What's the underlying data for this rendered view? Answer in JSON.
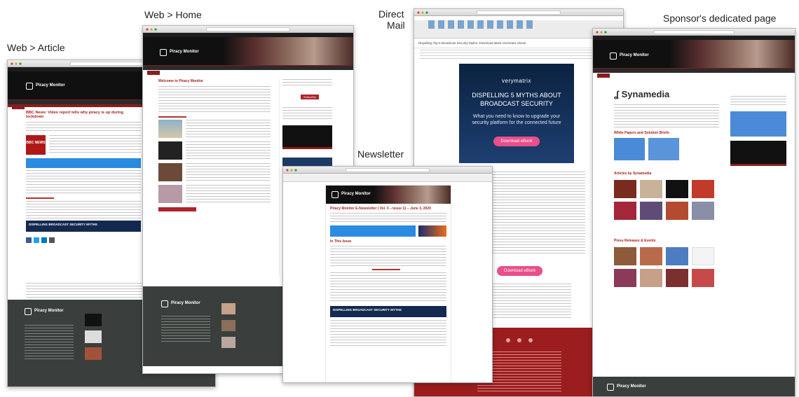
{
  "captions": {
    "web_article": "Web > Article",
    "web_home": "Web > Home",
    "direct_mail_line1": "Direct",
    "direct_mail_line2": "Mail",
    "newsletter": "Newsletter",
    "sponsor_page": "Sponsor's dedicated page"
  },
  "brand": {
    "name": "Piracy Monitor"
  },
  "article": {
    "headline": "BBC News: Video report tells why piracy is up during lockdown",
    "bbc_label": "BBC NEWS",
    "banner_text": "DISPELLING BROADCAST SECURITY MYTHS"
  },
  "home": {
    "welcome_title": "Welcome to Piracy Monitor",
    "subscribe_button": "Subscribe"
  },
  "direct_mail": {
    "subject": "Dispelling Top 5 Broadcast Security Myths: Download latest Verimatrix ebook",
    "ad_brand": "verymatrix",
    "ad_headline": "DISPELLING 5 MYTHS ABOUT BROADCAST SECURITY",
    "ad_subline": "What you need to know to upgrade your security platform for the connected future",
    "ad_button": "Download eBook",
    "ad_button_2": "Download eBook"
  },
  "newsletter": {
    "issue_title": "Piracy Monitor E-Newsletter | Vol. 3 – Issue 11 – June 3, 2020",
    "in_this_issue": "In This Issue",
    "banner_text": "DISPELLING BROADCAST SECURITY MYTHS"
  },
  "sponsor": {
    "company": "Synamedia",
    "section_papers": "White Papers and Solution Briefs",
    "section_articles": "Articles by Synamedia",
    "section_press": "Press Releases & Events"
  },
  "colors": {
    "accent_red": "#a8201a",
    "dark_footer": "#3a3f3d",
    "verimatrix_blue": "#14315e",
    "cta_pink": "#e84f8b"
  }
}
